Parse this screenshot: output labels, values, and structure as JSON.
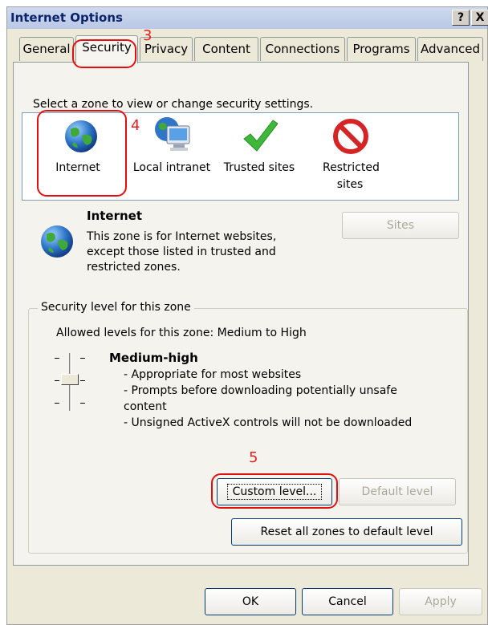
{
  "window": {
    "title": "Internet Options",
    "help_label": "?",
    "close_label": "X"
  },
  "tabs": [
    "General",
    "Security",
    "Privacy",
    "Content",
    "Connections",
    "Programs",
    "Advanced"
  ],
  "annotations": {
    "n3": "3",
    "n4": "4",
    "n5": "5"
  },
  "zones": {
    "prompt": "Select a zone to view or change security settings.",
    "items": [
      {
        "label": "Internet",
        "icon": "globe-icon"
      },
      {
        "label": "Local intranet",
        "icon": "intranet-icon"
      },
      {
        "label": "Trusted sites",
        "icon": "checkmark-icon"
      },
      {
        "label": "Restricted sites",
        "icon": "restricted-icon"
      }
    ],
    "selected": "Internet"
  },
  "zone_info": {
    "name": "Internet",
    "desc1": "This zone is for Internet websites,",
    "desc2": "except those listed in trusted and",
    "desc3": "restricted zones.",
    "sites_label": "Sites"
  },
  "security_level": {
    "group_title": "Security level for this zone",
    "allowed": "Allowed levels for this zone: Medium to High",
    "level_name": "Medium-high",
    "bullets": [
      "- Appropriate for most websites",
      "- Prompts before downloading potentially unsafe",
      "content",
      "- Unsigned ActiveX controls will not be downloaded"
    ],
    "custom_label": "Custom level...",
    "default_label": "Default level"
  },
  "reset_label": "Reset all zones to default level",
  "footer": {
    "ok": "OK",
    "cancel": "Cancel",
    "apply": "Apply"
  },
  "colors": {
    "title_text": "#0a246a",
    "annotation": "#e01010",
    "dialog_bg": "#ece9d8"
  }
}
